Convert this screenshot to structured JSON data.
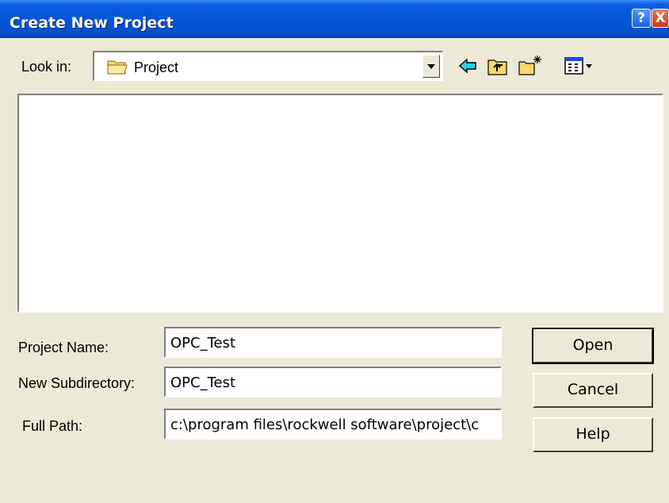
{
  "window": {
    "title": "Create New Project"
  },
  "titlebar_buttons": {
    "help": "?",
    "close": "X"
  },
  "look_in": {
    "label": "Look in:",
    "value": "Project"
  },
  "toolbar": {
    "icons": [
      "back-arrow-icon",
      "up-one-level-icon",
      "create-new-folder-icon",
      "view-menu-icon"
    ]
  },
  "file_list": {
    "items": []
  },
  "form": {
    "project_name_label": "Project Name:",
    "project_name_value": "OPC_Test",
    "subdirectory_label": "New Subdirectory:",
    "subdirectory_value": "OPC_Test",
    "full_path_label": "Full Path:",
    "full_path_value": "c:\\program files\\rockwell software\\project\\c"
  },
  "buttons": {
    "open": "Open",
    "cancel": "Cancel",
    "help": "Help"
  },
  "colors": {
    "titlebar": "#0556d8",
    "dialog_bg": "#ece9d8",
    "close_button": "#c6381e"
  }
}
